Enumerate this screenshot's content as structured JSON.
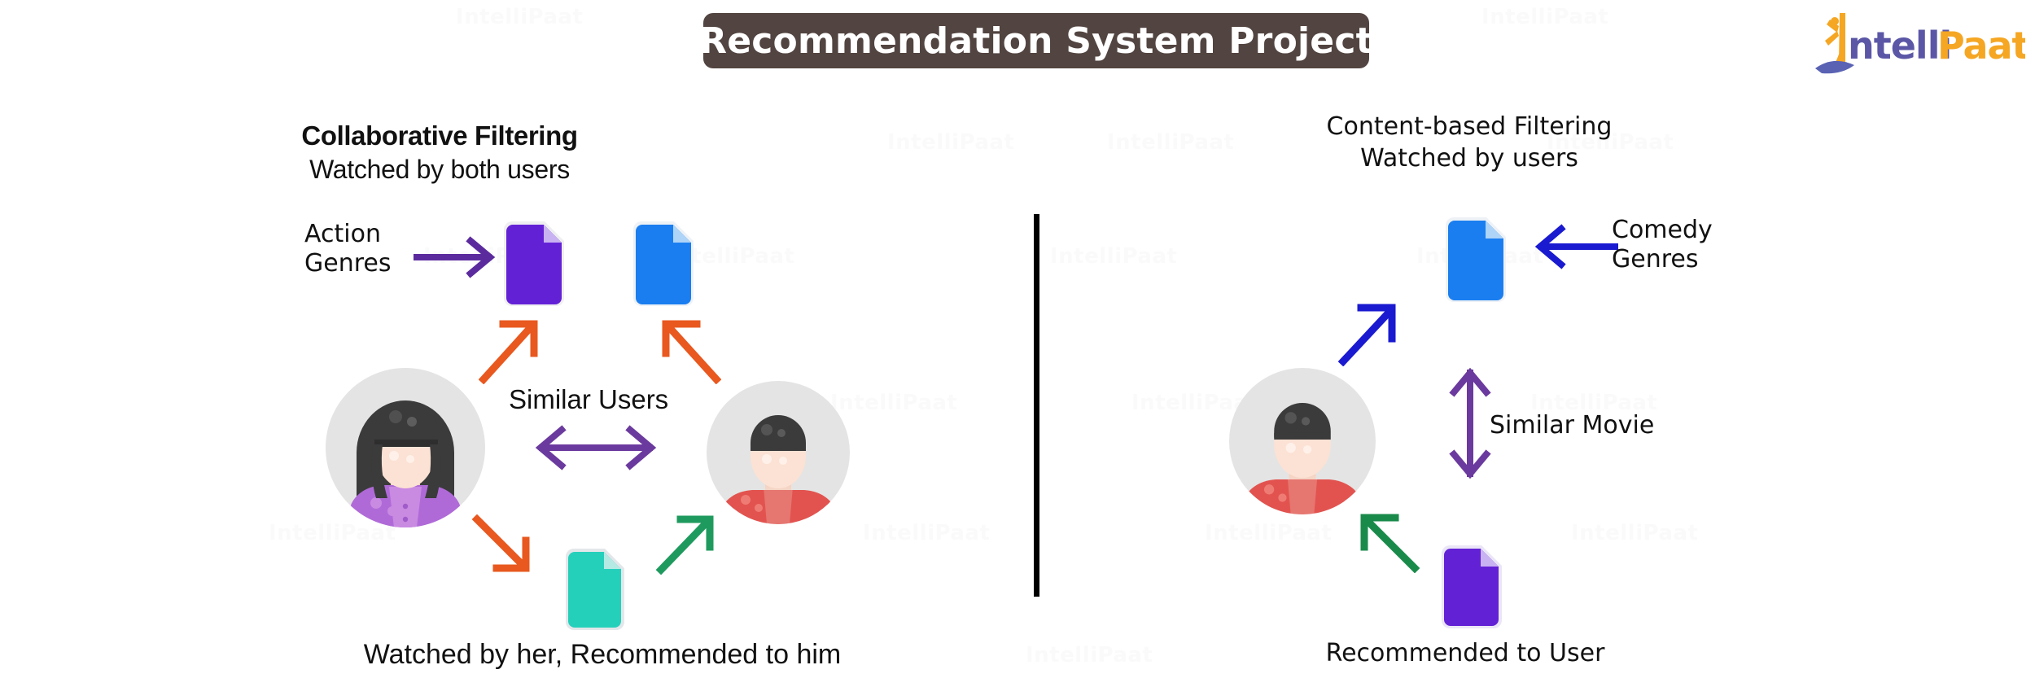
{
  "page": {
    "title": "Recommendation System Project",
    "background_color": "#ffffff",
    "watermark_text": "IntelliPaat"
  },
  "brand": {
    "logo_name": "IntelliPaat",
    "logo_part_1": "ntelli",
    "logo_part_2": "Paat",
    "purple": "#5b57a6",
    "orange": "#f5a623",
    "blue": "#5a62b4"
  },
  "title_banner": {
    "text": "Recommendation System Project",
    "background": "#524440",
    "text_color": "#ffffff"
  },
  "left_panel": {
    "heading_line1": "Collaborative Filtering",
    "heading_line2": "Watched by both users",
    "genre_label_line1": "Action",
    "genre_label_line2": "Genres",
    "middle_label": "Similar Users",
    "caption": "Watched by her, Recommended to him",
    "documents": [
      {
        "name": "doc-purple-top-left",
        "color": "#6321d6",
        "fold": "#c9b2f2"
      },
      {
        "name": "doc-blue-top-right",
        "color": "#1a7ef0",
        "fold": "#aed4f8"
      },
      {
        "name": "doc-teal-bottom",
        "color": "#25d0bb",
        "fold": "#b5e9e4"
      }
    ],
    "avatars": [
      {
        "name": "avatar-female",
        "shirt": "#b06ad8",
        "hair": "#3b3b3b",
        "skin": "#fce2d4",
        "bg": "#e4e4e4"
      },
      {
        "name": "avatar-male",
        "shirt": "#e2534f",
        "hair": "#3b3b3b",
        "skin": "#fce2d4",
        "bg": "#e4e4e4"
      }
    ],
    "arrow_colors": {
      "genre_arrow": "#5b2b9e",
      "similar_users_arrow": "#6b3a9e",
      "watch_arrow": "#e8581f",
      "recommend_arrow": "#1f9a5e"
    }
  },
  "right_panel": {
    "heading_line1": "Content-based Filtering",
    "heading_line2": "Watched by users",
    "genre_label_line1": "Comedy",
    "genre_label_line2": "Genres",
    "middle_label": "Similar Movie",
    "caption": "Recommended to User",
    "documents": [
      {
        "name": "doc-blue-top",
        "color": "#1a7ef0",
        "fold": "#aed4f8"
      },
      {
        "name": "doc-purple-bottom",
        "color": "#6321d6",
        "fold": "#c9b2f2"
      }
    ],
    "avatars": [
      {
        "name": "avatar-male",
        "shirt": "#e2534f",
        "hair": "#3b3b3b",
        "skin": "#fce2d4",
        "bg": "#e4e4e4"
      }
    ],
    "arrow_colors": {
      "genre_arrow": "#1a1ad0",
      "watch_arrow": "#1a1ad0",
      "similar_movie_arrow": "#6b3a9e",
      "recommend_arrow": "#1a8a4a"
    }
  },
  "divider": {
    "orientation": "vertical",
    "color": "#000000"
  }
}
